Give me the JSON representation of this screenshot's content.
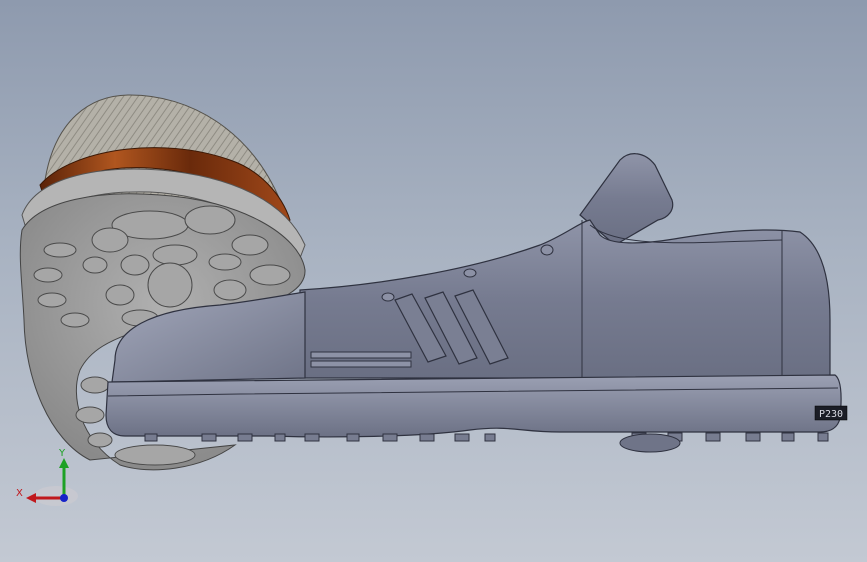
{
  "viewport": {
    "background_top": "#8e9aae",
    "background_bottom": "#c3c9d3"
  },
  "model": {
    "body_color": "#7d8296",
    "sole_color": "#6e7387",
    "wood_color": "#8a3d16",
    "tread_color": "#c8c8c8",
    "heel_label": "P230"
  },
  "triad": {
    "x_label": "X",
    "y_label": "Y",
    "x_color": "#c0181d",
    "y_color": "#1da125",
    "z_color": "#1522c8"
  }
}
